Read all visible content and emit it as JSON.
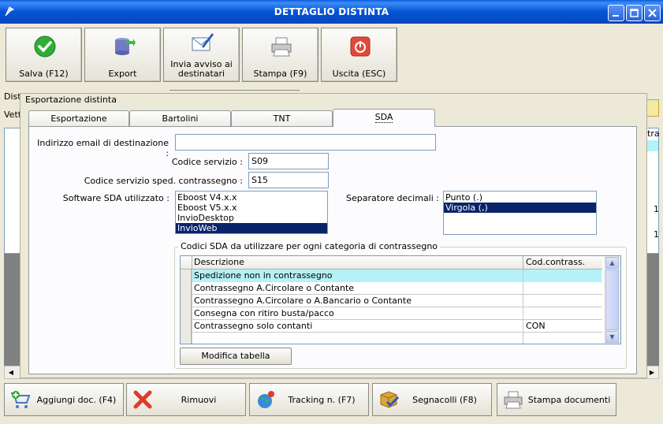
{
  "window": {
    "title": "DETTAGLIO DISTINTA"
  },
  "toolbar": {
    "save": "Salva (F12)",
    "export": "Export",
    "notify_line1": "Invia avviso ai",
    "notify_line2": "destinatari",
    "print": "Stampa (F9)",
    "exit": "Uscita (ESC)"
  },
  "background": {
    "dist_label": "Dist",
    "vett_label": "Vett",
    "tra_label": "tra",
    "row_val1": "1",
    "row_val2": "1"
  },
  "dialog": {
    "title": "Esportazione distinta",
    "tabs": [
      "Esportazione",
      "Bartolini",
      "TNT",
      "SDA"
    ],
    "email_label": "Indirizzo email di destinazione :",
    "email_value": "",
    "service_code_label": "Codice servizio :",
    "service_code_value": "S09",
    "cod_service_label": "Codice servizio sped. contrassegno :",
    "cod_service_value": "S15",
    "software_label": "Software SDA utilizzato :",
    "software_options": [
      "Eboost V4.x.x",
      "Eboost V5.x.x",
      "InvioDesktop",
      "InvioWeb"
    ],
    "software_selected": "InvioWeb",
    "decimal_label": "Separatore decimali :",
    "decimal_options": [
      "Punto (.)",
      "Virgola (,)"
    ],
    "decimal_selected": "Virgola (,)",
    "group_title": "Codici SDA da utilizzare per ogni categoria di contrassegno",
    "grid_headers": [
      "Descrizione",
      "Cod.contrass."
    ],
    "grid_rows": [
      {
        "desc": "Spedizione non in contrassegno",
        "code": ""
      },
      {
        "desc": "Contrassegno A.Circolare o Contante",
        "code": ""
      },
      {
        "desc": "Contrassegno A.Circolare o A.Bancario o Contante",
        "code": ""
      },
      {
        "desc": "Consegna con ritiro busta/pacco",
        "code": ""
      },
      {
        "desc": "Contrassegno solo contanti",
        "code": "CON"
      },
      {
        "desc": "",
        "code": ""
      }
    ],
    "modify_button": "Modifica tabella"
  },
  "bottom": {
    "add": "Aggiungi doc. (F4)",
    "remove": "Rimuovi",
    "tracking": "Tracking n. (F7)",
    "labels": "Segnacolli (F8)",
    "print_docs": "Stampa documenti"
  },
  "colors": {
    "titlebar": "#0754d6",
    "selection": "#0a246a",
    "highlight_row": "#b5f1f8"
  }
}
